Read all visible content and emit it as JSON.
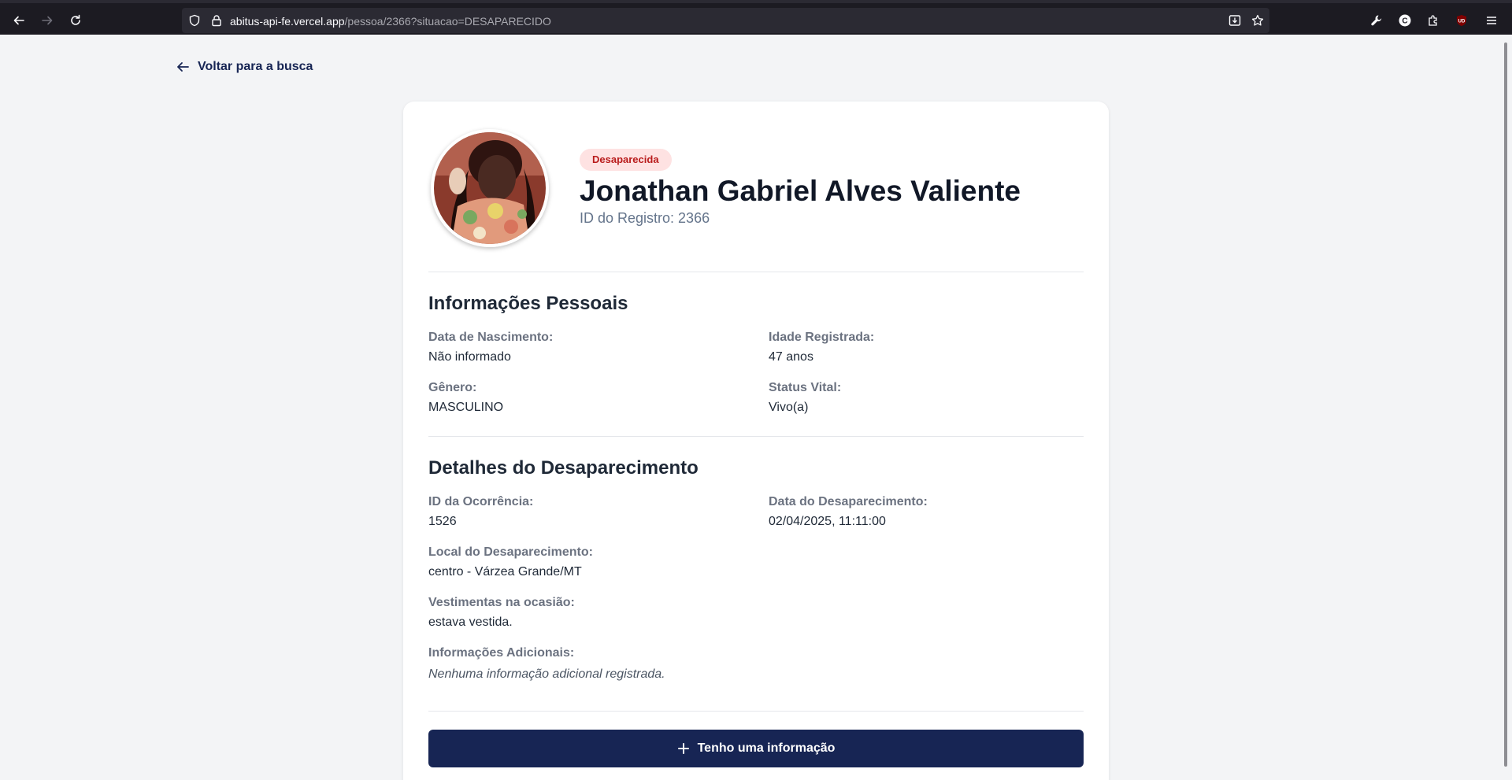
{
  "browser": {
    "url_host": "abitus-api-fe.vercel.app",
    "url_path": "/pessoa/2366?situacao=DESAPARECIDO"
  },
  "page": {
    "back_label": "Voltar para a busca"
  },
  "person": {
    "status_badge": "Desaparecida",
    "name": "Jonathan Gabriel Alves Valiente",
    "registry_id": "ID do Registro: 2366"
  },
  "personal_info": {
    "title": "Informações Pessoais",
    "fields": [
      {
        "label": "Data de Nascimento:",
        "value": "Não informado"
      },
      {
        "label": "Idade Registrada:",
        "value": "47 anos"
      },
      {
        "label": "Gênero:",
        "value": "MASCULINO"
      },
      {
        "label": "Status Vital:",
        "value": "Vivo(a)"
      }
    ]
  },
  "disappearance": {
    "title": "Detalhes do Desaparecimento",
    "fields": [
      {
        "label": "ID da Ocorrência:",
        "value": "1526"
      },
      {
        "label": "Data do Desaparecimento:",
        "value": "02/04/2025, 11:11:00"
      },
      {
        "label": "Local do Desaparecimento:",
        "value": "centro - Várzea Grande/MT"
      },
      {
        "label": "Vestimentas na ocasião:",
        "value": "estava vestida."
      },
      {
        "label": "Informações Adicionais:",
        "value": "Nenhuma informação adicional registrada."
      }
    ]
  },
  "action": {
    "button_label": "Tenho uma informação"
  },
  "colors": {
    "primary": "#172554",
    "badge_bg": "#fee2e2",
    "badge_text": "#b91c1c",
    "page_bg": "#f3f4f6"
  }
}
